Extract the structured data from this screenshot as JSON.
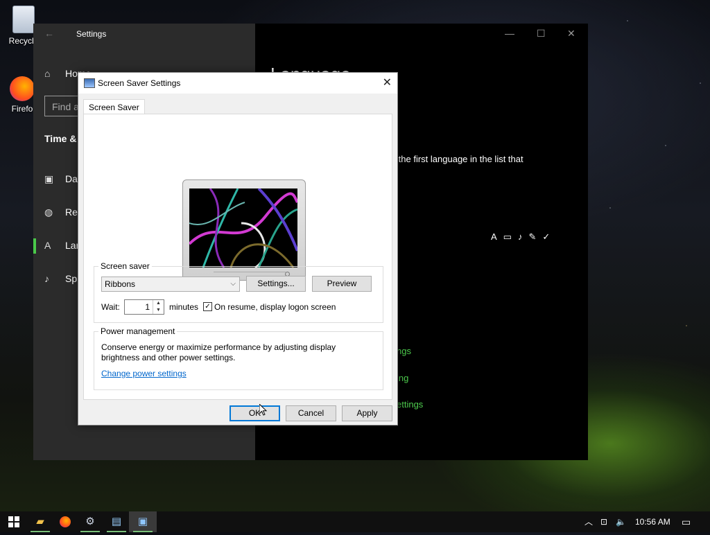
{
  "desktop": {
    "icons": [
      {
        "label": "Recycle",
        "icon": "recycle-bin-icon"
      },
      {
        "label": "Firefo",
        "icon": "firefox-icon"
      }
    ]
  },
  "settings_window": {
    "title": "Settings",
    "nav": {
      "home": "Home",
      "search_placeholder": "Find a",
      "section": "Time &",
      "items": [
        "Da",
        "Re",
        "Lar",
        "Sp"
      ]
    },
    "right": {
      "heading": "Language",
      "text": "r in the first language in the list that",
      "partial": ")",
      "links": [
        "ngs",
        "ing",
        "ettings"
      ]
    }
  },
  "dialog": {
    "title": "Screen Saver Settings",
    "tab": "Screen Saver",
    "screen_saver": {
      "group_label": "Screen saver",
      "selected": "Ribbons",
      "settings_button": "Settings...",
      "preview_button": "Preview",
      "wait_label": "Wait:",
      "wait_value": "1",
      "minutes_label": "minutes",
      "resume_checked": true,
      "resume_label": "On resume, display logon screen"
    },
    "power": {
      "group_label": "Power management",
      "description_line1": "Conserve energy or maximize performance by adjusting display",
      "description_line2": "brightness and other power settings.",
      "link": "Change power settings"
    },
    "buttons": {
      "ok": "OK",
      "cancel": "Cancel",
      "apply": "Apply"
    }
  },
  "taskbar": {
    "time": "10:56 AM"
  },
  "colors": {
    "accent_green": "#4fcf4f",
    "dialog_default_button": "#0078d7"
  }
}
